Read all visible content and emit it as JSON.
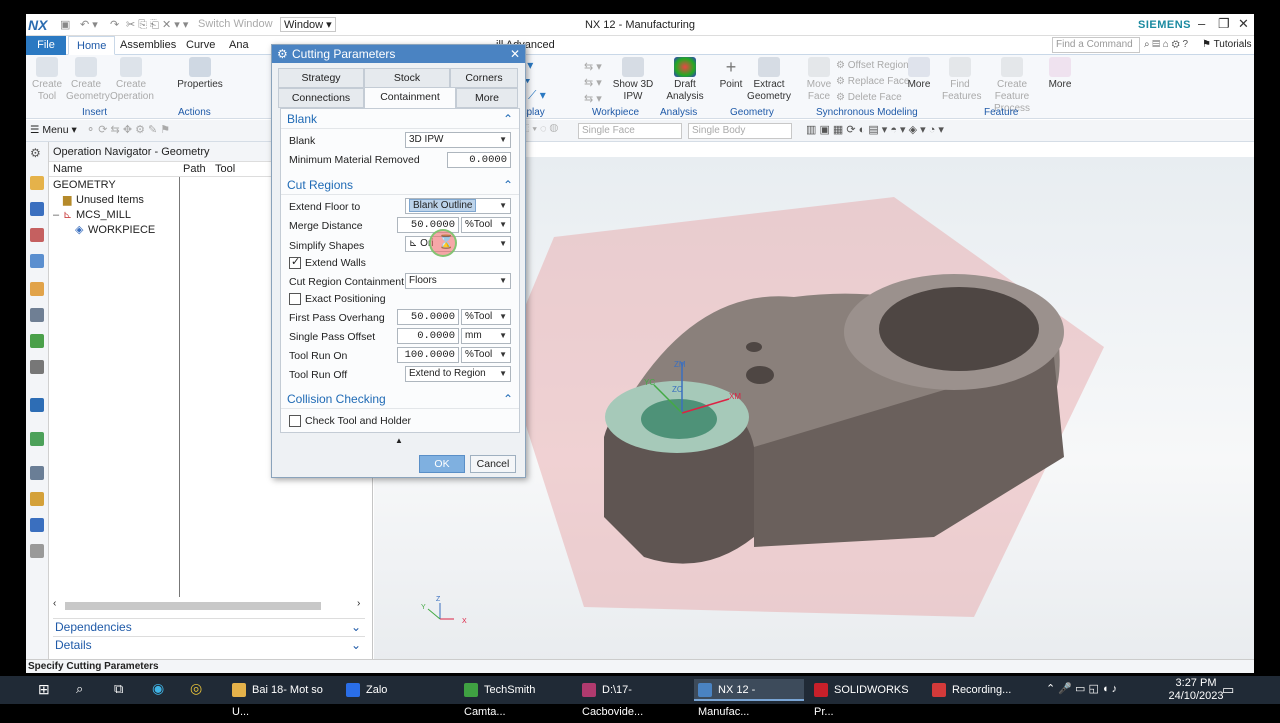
{
  "app": {
    "logo": "NX",
    "title": "NX 12 - Manufacturing",
    "brand": "SIEMENS",
    "switch_window": "Switch Window",
    "window_menu": "Window ▾",
    "tabs": [
      "File",
      "Home",
      "Assemblies",
      "Curve",
      "Ana",
      "ill Advanced"
    ],
    "active_tab": "Home",
    "search_placeholder": "Find a Command",
    "tutorials": "Tutorials"
  },
  "ribbon": {
    "insert": {
      "create_tool": "Create Tool",
      "create_geometry": "Create Geometry",
      "create_operation": "Create Operation",
      "group": "Insert"
    },
    "actions": {
      "properties": "Properties",
      "group": "Actions"
    },
    "display": {
      "group": "Display"
    },
    "workpiece": {
      "show_3d_ipw": "Show 3D IPW",
      "group": "Workpiece"
    },
    "analysis": {
      "draft_analysis": "Draft Analysis",
      "group": "Analysis"
    },
    "geometry": {
      "point": "Point",
      "extract_geometry": "Extract Geometry",
      "group": "Geometry"
    },
    "synchronous": {
      "move_face": "Move Face",
      "offset_region": "Offset Region",
      "replace_face": "Replace Face",
      "delete_face": "Delete Face",
      "more": "More",
      "group": "Synchronous Modeling"
    },
    "feature": {
      "find_features": "Find Features",
      "create_feature_process": "Create Feature Process",
      "more": "More",
      "group": "Feature"
    }
  },
  "cmdbar": {
    "menu": "Menu ▾",
    "filter1": "Single Face",
    "filter2": "Single Body"
  },
  "navigator": {
    "title": "Operation Navigator - Geometry",
    "columns": [
      "Name",
      "Path",
      "Tool"
    ],
    "rows": [
      "GEOMETRY",
      "Unused Items",
      "MCS_MILL",
      "WORKPIECE"
    ],
    "dependencies": "Dependencies",
    "details": "Details"
  },
  "dialog": {
    "title": "Cutting Parameters",
    "tabs_row1": [
      "Strategy",
      "Stock",
      "Corners"
    ],
    "tabs_row2": [
      "Connections",
      "Containment",
      "More"
    ],
    "active_tab": "Containment",
    "blank_section": "Blank",
    "blank_label": "Blank",
    "blank_value": "3D IPW",
    "min_material_label": "Minimum Material Removed",
    "min_material_value": "0.0000",
    "cut_regions_section": "Cut Regions",
    "extend_floor_label": "Extend Floor to",
    "extend_floor_value": "Blank Outline",
    "merge_distance_label": "Merge Distance",
    "merge_distance_value": "50.0000",
    "merge_distance_unit": "%Tool",
    "simplify_label": "Simplify Shapes",
    "simplify_value": "Ori",
    "extend_walls_label": "Extend Walls",
    "extend_walls_checked": true,
    "containment_label": "Cut Region Containment",
    "containment_value": "Floors",
    "exact_positioning_label": "Exact Positioning",
    "exact_positioning_checked": false,
    "first_pass_label": "First Pass Overhang",
    "first_pass_value": "50.0000",
    "first_pass_unit": "%Tool",
    "single_pass_label": "Single Pass Offset",
    "single_pass_value": "0.0000",
    "single_pass_unit": "mm",
    "run_on_label": "Tool Run On",
    "run_on_value": "100.0000",
    "run_on_unit": "%Tool",
    "run_off_label": "Tool Run Off",
    "run_off_value": "Extend to Region",
    "collision_section": "Collision Checking",
    "check_tool_label": "Check Tool and Holder",
    "check_tool_checked": false,
    "ok": "OK",
    "cancel": "Cancel"
  },
  "viewport": {
    "axis_labels": [
      "ZM",
      "YC",
      "ZC",
      "XM"
    ],
    "triad": [
      "Z",
      "Y",
      "X"
    ]
  },
  "status": "Specify Cutting Parameters",
  "taskbar": {
    "apps": [
      "Bai 18- Mot so U...",
      "Zalo",
      "TechSmith Camta...",
      "D:\\17-Cacbovide...",
      "NX 12 - Manufac...",
      "SOLIDWORKS Pr...",
      "Recording..."
    ],
    "active_app": "NX 12 - Manufac...",
    "time": "3:27 PM",
    "date": "24/10/2023"
  },
  "colors": {
    "accent": "#2b79c2",
    "dialog_title": "#4a83c2",
    "section": "#1f6ab5",
    "taskbar": "#202a36",
    "part": "#5f5552",
    "blank": "#e7a2a4"
  }
}
